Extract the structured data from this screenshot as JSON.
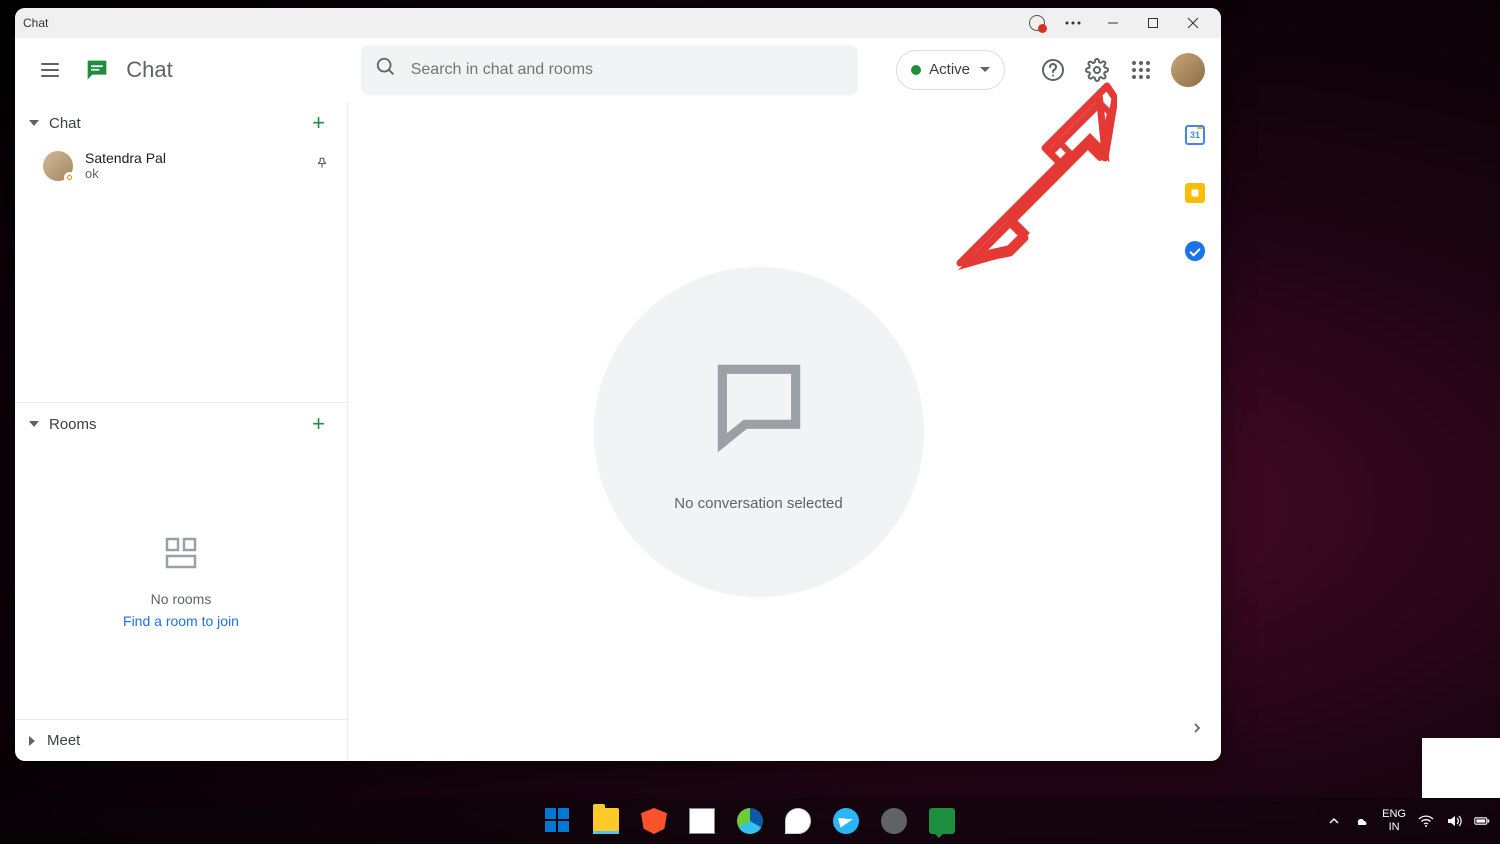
{
  "titlebar": {
    "title": "Chat"
  },
  "header": {
    "app_name": "Chat",
    "search_placeholder": "Search in chat and rooms",
    "status": {
      "label": "Active"
    }
  },
  "sidebar": {
    "chat": {
      "title": "Chat",
      "items": [
        {
          "name": "Satendra Pal",
          "preview": "ok"
        }
      ]
    },
    "rooms": {
      "title": "Rooms",
      "empty_text": "No rooms",
      "find_link": "Find a room to join"
    },
    "meet": {
      "title": "Meet"
    }
  },
  "main": {
    "empty_message": "No conversation selected"
  },
  "taskbar": {
    "lang1": "ENG",
    "lang2": "IN"
  }
}
